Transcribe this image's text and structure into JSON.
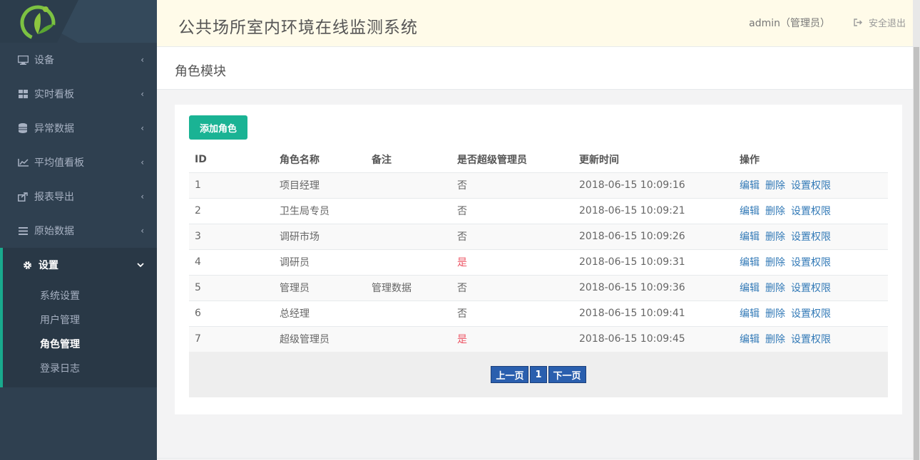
{
  "header": {
    "app_title": "公共场所室内环境在线监测系统",
    "user": "admin（管理员）",
    "logout_label": "安全退出"
  },
  "sidebar": {
    "items": [
      {
        "label": "设备",
        "icon": "monitor-icon"
      },
      {
        "label": "实时看板",
        "icon": "grid-icon"
      },
      {
        "label": "异常数据",
        "icon": "database-icon"
      },
      {
        "label": "平均值看板",
        "icon": "line-chart-icon"
      },
      {
        "label": "报表导出",
        "icon": "export-icon"
      },
      {
        "label": "原始数据",
        "icon": "list-icon"
      },
      {
        "label": "设置",
        "icon": "gear-icon"
      }
    ],
    "settings_sub": [
      {
        "label": "系统设置"
      },
      {
        "label": "用户管理"
      },
      {
        "label": "角色管理"
      },
      {
        "label": "登录日志"
      }
    ]
  },
  "page": {
    "title": "角色模块",
    "add_button": "添加角色"
  },
  "table": {
    "headers": [
      "ID",
      "角色名称",
      "备注",
      "是否超级管理员",
      "更新时间",
      "操作"
    ],
    "rows": [
      {
        "id": "1",
        "name": "项目经理",
        "note": "",
        "super": "否",
        "updated": "2018-06-15 10:09:16"
      },
      {
        "id": "2",
        "name": "卫生局专员",
        "note": "",
        "super": "否",
        "updated": "2018-06-15 10:09:21"
      },
      {
        "id": "3",
        "name": "调研市场",
        "note": "",
        "super": "否",
        "updated": "2018-06-15 10:09:26"
      },
      {
        "id": "4",
        "name": "调研员",
        "note": "",
        "super": "是",
        "updated": "2018-06-15 10:09:31"
      },
      {
        "id": "5",
        "name": "管理员",
        "note": "管理数据",
        "super": "否",
        "updated": "2018-06-15 10:09:36"
      },
      {
        "id": "6",
        "name": "总经理",
        "note": "",
        "super": "否",
        "updated": "2018-06-15 10:09:41"
      },
      {
        "id": "7",
        "name": "超级管理员",
        "note": "",
        "super": "是",
        "updated": "2018-06-15 10:09:45"
      }
    ],
    "actions": {
      "edit": "编辑",
      "delete": "删除",
      "perm": "设置权限"
    }
  },
  "pagination": {
    "prev": "上一页",
    "page": "1",
    "next": "下一页"
  },
  "colors": {
    "sidebar_bg": "#2f4050",
    "accent": "#1ab394",
    "link": "#337ab7",
    "danger": "#ed5565",
    "pager": "#2a5fae"
  }
}
